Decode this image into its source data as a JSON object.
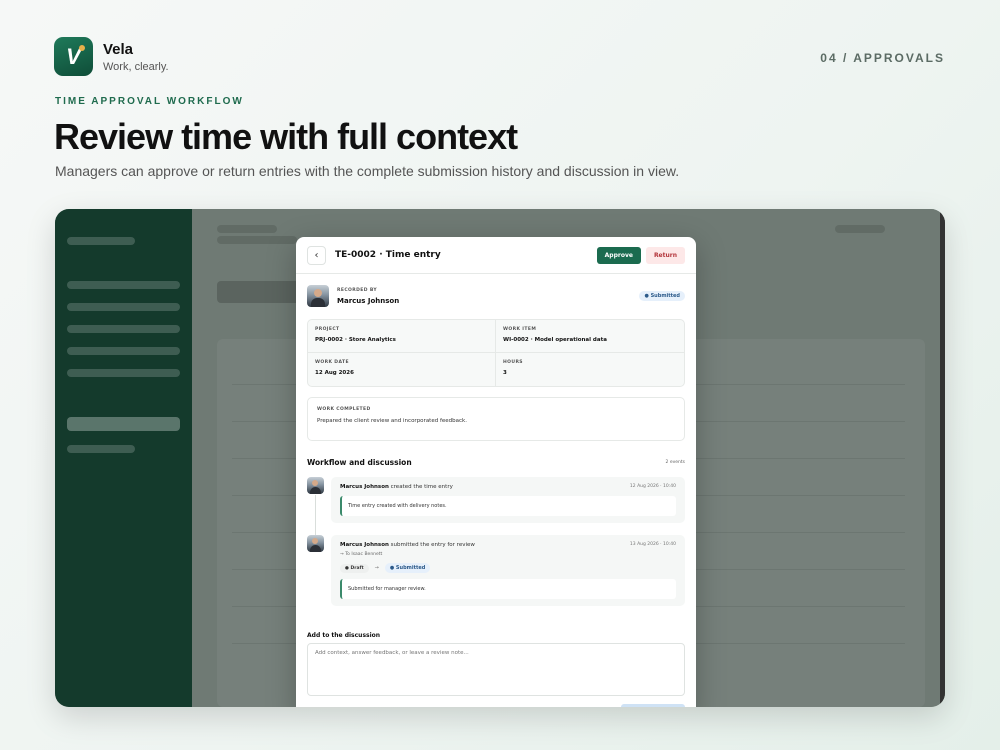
{
  "brand": {
    "name": "Vela",
    "tagline": "Work, clearly.",
    "logo_letter": "V",
    "accent": "#1b6b4f"
  },
  "page_index": "04 / APPROVALS",
  "eyebrow": "TIME APPROVAL WORKFLOW",
  "headline": "Review time with full context",
  "subline": "Managers can approve or return entries with the complete submission history and discussion in view.",
  "modal": {
    "title": "TE-0002 · Time entry",
    "back_icon": "chevron-left-icon",
    "approve_label": "Approve",
    "return_label": "Return",
    "recorded_by_label": "RECORDED BY",
    "recorded_by_name": "Marcus Johnson",
    "status_label": "Submitted",
    "details": {
      "project_label": "PROJECT",
      "project_value": "PRJ-0002 · Store Analytics",
      "work_item_label": "WORK ITEM",
      "work_item_value": "WI-0002 · Model operational data",
      "work_date_label": "WORK DATE",
      "work_date_value": "12 Aug 2026",
      "hours_label": "HOURS",
      "hours_value": "3"
    },
    "work_completed_label": "WORK COMPLETED",
    "work_completed_text": "Prepared the client review and incorporated feedback.",
    "workflow_title": "Workflow and discussion",
    "workflow_count": "2 events",
    "events": [
      {
        "actor": "Marcus Johnson",
        "action": "created the time entry",
        "time": "12 Aug 2026 · 10:40",
        "note": "Time entry created with delivery notes."
      },
      {
        "actor": "Marcus Johnson",
        "action": "submitted the entry for review",
        "time": "13 Aug 2026 · 10:40",
        "sub": "→ To Isaac Bennett",
        "from_status": "Draft",
        "to_status": "Submitted",
        "note": "Submitted for manager review."
      }
    ],
    "add_label": "Add to the discussion",
    "add_placeholder": "Add context, answer feedback, or leave a review note..."
  }
}
